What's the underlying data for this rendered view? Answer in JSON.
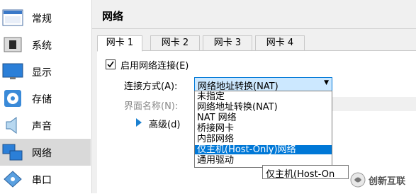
{
  "sidebar": {
    "items": [
      {
        "label": "常规",
        "icon": "general-icon"
      },
      {
        "label": "系统",
        "icon": "system-chip-icon"
      },
      {
        "label": "显示",
        "icon": "display-monitor-icon"
      },
      {
        "label": "存储",
        "icon": "storage-disc-icon"
      },
      {
        "label": "声音",
        "icon": "speaker-icon"
      },
      {
        "label": "网络",
        "icon": "network-icon",
        "selected": true
      },
      {
        "label": "串口",
        "icon": "serial-port-icon"
      }
    ]
  },
  "panel": {
    "title": "网络",
    "tabs": [
      {
        "label": "网卡 1",
        "active": true
      },
      {
        "label": "网卡 2"
      },
      {
        "label": "网卡 3"
      },
      {
        "label": "网卡 4"
      }
    ],
    "enable_checkbox": {
      "label": "启用网络连接(E)",
      "checked": true
    },
    "attached_to": {
      "label": "连接方式(A):",
      "value": "网络地址转换(NAT)",
      "options": [
        "未指定",
        "网络地址转换(NAT)",
        "NAT 网络",
        "桥接网卡",
        "内部网络",
        "仅主机(Host-Only)网络",
        "通用驱动"
      ],
      "highlighted_index": 5
    },
    "interface_name_label": "界面名称(N):",
    "advanced_label": "高级(d)",
    "tooltip": "仅主机(Host-On"
  },
  "watermark": {
    "text": "创新互联"
  },
  "colors": {
    "selection": "#0078d7",
    "selected_field": "#cce8ff",
    "sidebar_selected": "#d9d9d9"
  }
}
